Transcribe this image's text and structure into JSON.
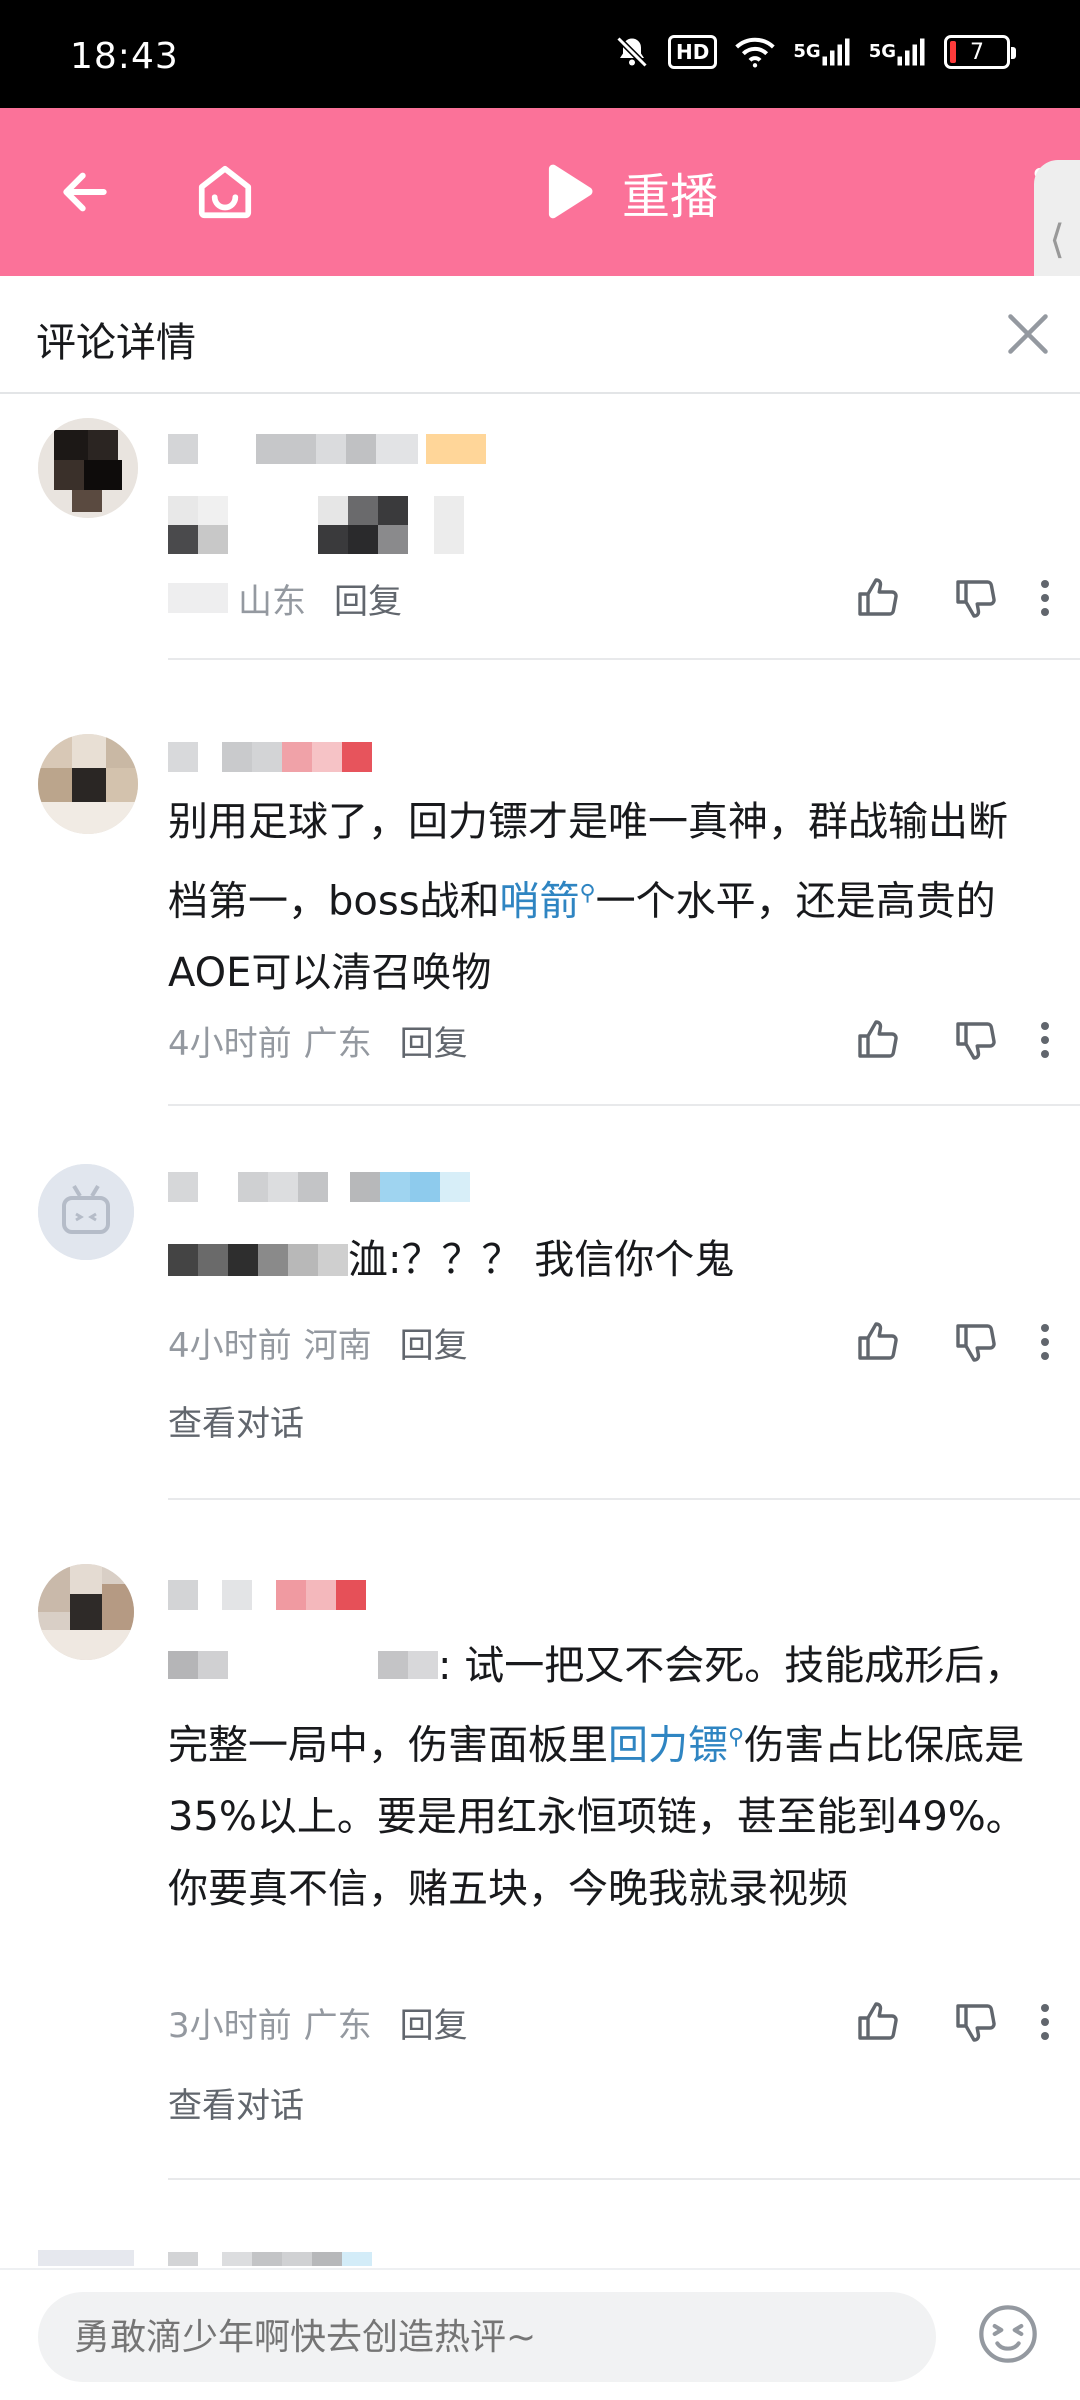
{
  "status_bar": {
    "time": "18:43",
    "hd_label": "HD",
    "network_1": "5G",
    "network_2": "5G",
    "battery": "7"
  },
  "header": {
    "replay_label": "重播",
    "side_tab_glyph": "⟨"
  },
  "panel": {
    "title": "评论详情"
  },
  "comments": [
    {
      "location": "山东",
      "reply_label": "回复"
    },
    {
      "body_1": "别用足球了，回力镖才是唯一真神，群战输出断档第一，boss战和",
      "keyword": "哨箭",
      "body_2": "一个水平，还是高贵的AOE可以清召唤物",
      "time": "4小时前",
      "location": "广东",
      "reply_label": "回复"
    },
    {
      "body_suffix": "洫:？？？ 我信你个鬼",
      "time": "4小时前",
      "location": "河南",
      "reply_label": "回复",
      "view_conversation": "查看对话"
    },
    {
      "body_1": ": 试一把又不会死。技能成形后，完整一局中，伤害面板里",
      "keyword": "回力镖",
      "body_2": "伤害占比保底是35%以上。要是用红永恒项链，甚至能到49%。你要真不信，赌五块，今晚我就录视频",
      "time": "3小时前",
      "location": "广东",
      "reply_label": "回复",
      "view_conversation": "查看对话"
    }
  ],
  "search_glyph": "⚲",
  "input": {
    "placeholder": "勇敢滴少年啊快去创造热评~"
  },
  "colors": {
    "brand_pink": "#fb7299",
    "keyword_blue": "#2f85c2",
    "level_badge": "#ffb027"
  }
}
